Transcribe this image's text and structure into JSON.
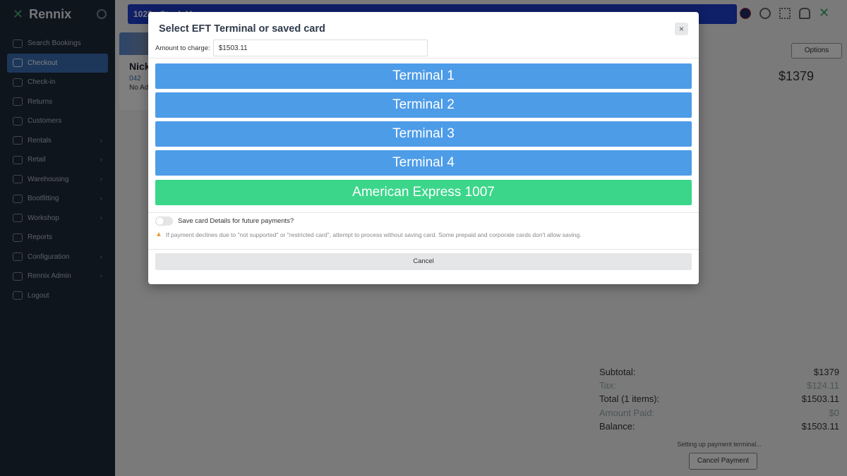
{
  "sidebar": {
    "brand": "Rennix",
    "items": [
      {
        "label": "Search Bookings",
        "has_children": false
      },
      {
        "label": "Checkout",
        "has_children": false,
        "active": true
      },
      {
        "label": "Check-in",
        "has_children": false
      },
      {
        "label": "Returns",
        "has_children": false
      },
      {
        "label": "Customers",
        "has_children": false
      },
      {
        "label": "Rentals",
        "has_children": true
      },
      {
        "label": "Retail",
        "has_children": true
      },
      {
        "label": "Warehousing",
        "has_children": true
      },
      {
        "label": "Bootfitting",
        "has_children": true
      },
      {
        "label": "Workshop",
        "has_children": true
      },
      {
        "label": "Reports",
        "has_children": false
      },
      {
        "label": "Configuration",
        "has_children": true
      },
      {
        "label": "Rennix Admin",
        "has_children": true
      },
      {
        "label": "Logout",
        "has_children": false
      }
    ]
  },
  "topbar": {
    "text": "1023 - Stock M"
  },
  "customer": {
    "name": "Nick",
    "phone": "042",
    "note": "No Ad"
  },
  "main": {
    "options_label": "Options",
    "header_total": "$1379"
  },
  "summary": {
    "rows": [
      {
        "label": "Subtotal:",
        "value": "$1379",
        "faded": false
      },
      {
        "label": "Tax:",
        "value": "$124.11",
        "faded": true
      },
      {
        "label": "Total (1 items):",
        "value": "$1503.11",
        "faded": false
      },
      {
        "label": "Amount Paid:",
        "value": "$0",
        "faded": true
      },
      {
        "label": "Balance:",
        "value": "$1503.11",
        "faded": false
      }
    ],
    "status": "Setting up payment terminal...",
    "cancel_payment_label": "Cancel Payment"
  },
  "modal": {
    "title": "Select EFT Terminal or saved card",
    "close_label": "×",
    "amount_label": "Amount to charge:",
    "amount_value": "$1503.11",
    "terminals": [
      "Terminal 1",
      "Terminal 2",
      "Terminal 3",
      "Terminal 4"
    ],
    "saved_card": "American Express 1007",
    "save_card_label": "Save card Details for future payments?",
    "warning_text": "If payment declines due to \"not supported\" or \"restricted card\", attempt to process without saving card. Some prepaid and corporate cards don't allow saving.",
    "cancel_label": "Cancel",
    "colors": {
      "terminal": "#4d9ce8",
      "saved_card": "#3bd68a"
    }
  }
}
